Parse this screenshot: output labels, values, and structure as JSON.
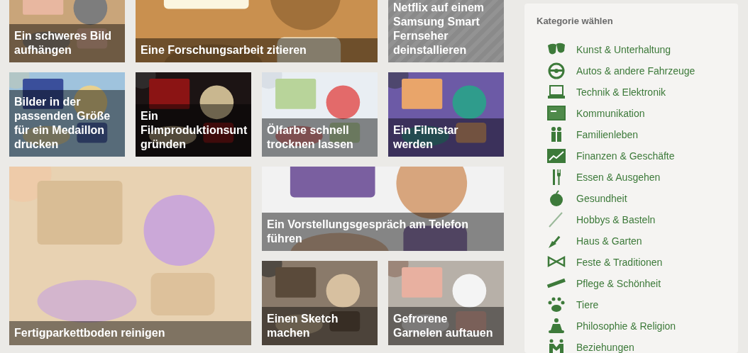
{
  "tiles": [
    {
      "kind": "picture",
      "caption": "Ein schweres Bild aufhängen"
    },
    {
      "kind": "picture",
      "caption": "Eine Forschungsarbeit zitieren"
    },
    {
      "kind": "placeholder",
      "caption": "Netflix auf einem Samsung Smart Fernseher deinstallieren"
    },
    {
      "kind": "picture",
      "caption": "Bilder in der passenden Größe für ein Medaillon drucken"
    },
    {
      "kind": "picture",
      "caption": "Ein Filmproduktionsunt gründen"
    },
    {
      "kind": "picture",
      "caption": "Ölfarbe schnell trocknen lassen"
    },
    {
      "kind": "picture",
      "caption": "Ein Filmstar werden"
    },
    {
      "kind": "picture",
      "caption": "Fertigparkettboden reinigen"
    },
    {
      "kind": "picture",
      "caption": "Ein Vorstellungsgespräch am Telefon führen"
    },
    {
      "kind": "picture",
      "caption": "Einen Sketch machen"
    },
    {
      "kind": "picture",
      "caption": "Gefrorene Garnelen auftauen"
    }
  ],
  "sidebar": {
    "title": "Kategorie wählen",
    "items": [
      "Kunst & Unterhaltung",
      "Autos & andere Fahrzeuge",
      "Technik & Elektronik",
      "Kommunikation",
      "Familienleben",
      "Finanzen & Geschäfte",
      "Essen & Ausgehen",
      "Gesundheit",
      "Hobbys & Basteln",
      "Haus & Garten",
      "Feste & Traditionen",
      "Pflege & Schönheit",
      "Tiere",
      "Philosophie & Religion",
      "Beziehungen"
    ]
  }
}
